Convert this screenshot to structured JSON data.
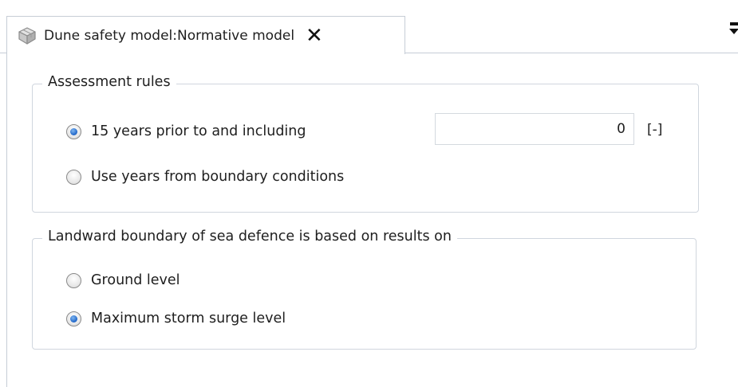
{
  "tab": {
    "title": "Dune safety model:Normative model",
    "close_glyph": "✕",
    "icon": "gray-box-model-icon"
  },
  "assessment_rules": {
    "title": "Assessment rules",
    "options": [
      {
        "label": "15 years prior to and including",
        "checked": true
      },
      {
        "label": "Use years from boundary conditions",
        "checked": false
      }
    ],
    "year_value": "0",
    "unit": "[-]"
  },
  "landward_boundary": {
    "title": "Landward boundary of sea defence is based on results on",
    "options": [
      {
        "label": "Ground level",
        "checked": false
      },
      {
        "label": "Maximum storm surge level",
        "checked": true
      }
    ]
  }
}
